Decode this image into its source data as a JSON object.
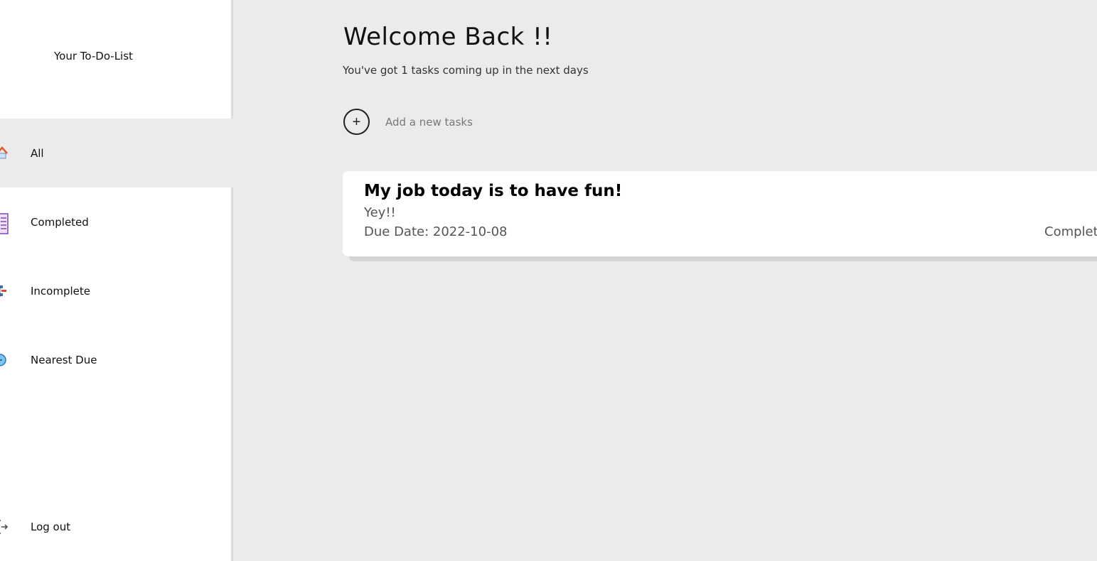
{
  "sidebar": {
    "brand": "Your To-Do-List",
    "items": [
      {
        "label": "All",
        "icon": "home-icon",
        "active": true
      },
      {
        "label": "Completed",
        "icon": "list-icon",
        "active": false
      },
      {
        "label": "Incomplete",
        "icon": "tasks-icon",
        "active": false
      },
      {
        "label": "Nearest Due",
        "icon": "clock-icon",
        "active": false
      }
    ],
    "logout": {
      "label": "Log out",
      "icon": "logout-icon"
    }
  },
  "main": {
    "title": "Welcome Back !!",
    "subtitle": "You've got 1 tasks coming up in the next days",
    "add_task": {
      "label": "Add a new tasks",
      "button_symbol": "+"
    },
    "tasks": [
      {
        "title": "My job today is to have fun!",
        "description": "Yey!!",
        "due": "Due Date: 2022-10-08",
        "status": "Completed"
      }
    ]
  },
  "colors": {
    "background": "#ebebeb",
    "sidebar": "#ffffff",
    "active_item": "#ebebeb",
    "card": "#ffffff"
  }
}
